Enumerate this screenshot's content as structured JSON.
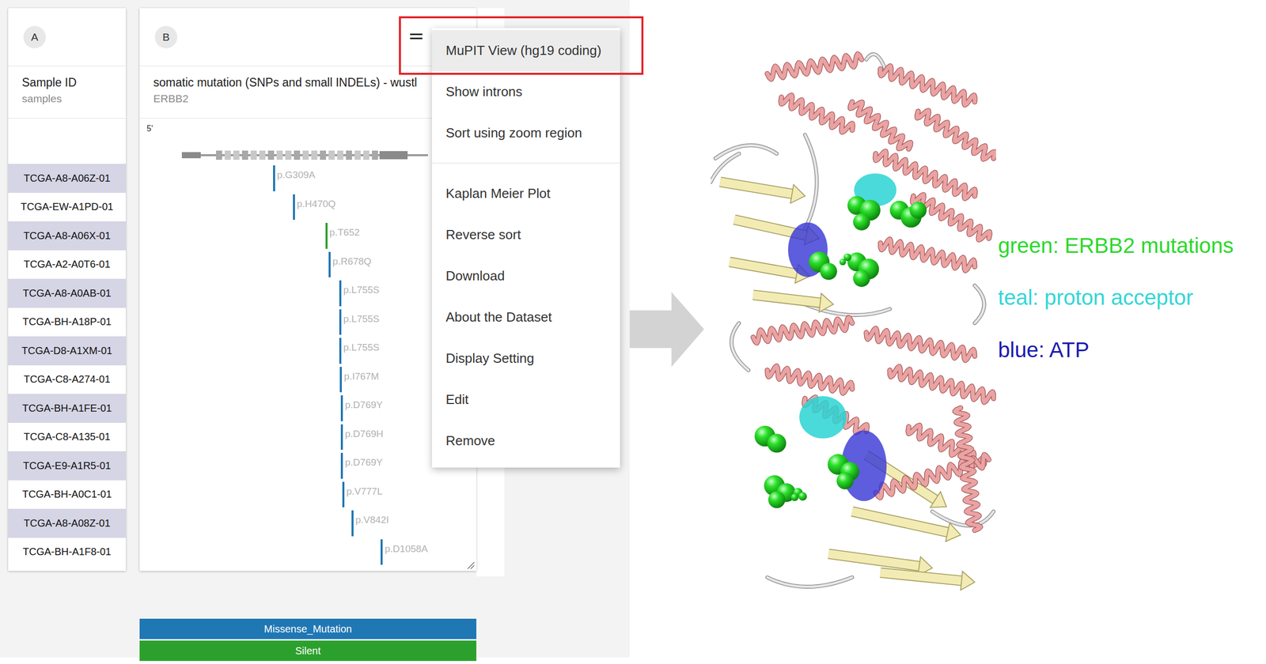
{
  "sample_column": {
    "badge": "A",
    "title": "Sample ID",
    "subtitle": "samples",
    "rows": [
      {
        "id": "TCGA-A8-A06Z-01"
      },
      {
        "id": "TCGA-EW-A1PD-01"
      },
      {
        "id": "TCGA-A8-A06X-01"
      },
      {
        "id": "TCGA-A2-A0T6-01"
      },
      {
        "id": "TCGA-A8-A0AB-01"
      },
      {
        "id": "TCGA-BH-A18P-01"
      },
      {
        "id": "TCGA-D8-A1XM-01"
      },
      {
        "id": "TCGA-C8-A274-01"
      },
      {
        "id": "TCGA-BH-A1FE-01"
      },
      {
        "id": "TCGA-C8-A135-01"
      },
      {
        "id": "TCGA-E9-A1R5-01"
      },
      {
        "id": "TCGA-BH-A0C1-01"
      },
      {
        "id": "TCGA-A8-A08Z-01"
      },
      {
        "id": "TCGA-BH-A1F8-01"
      }
    ]
  },
  "mutation_column": {
    "badge": "B",
    "title": "somatic mutation (SNPs and small INDELs) - wustl",
    "subtitle": "ERBB2",
    "strand": "5'",
    "rows": [
      {
        "label": "p.G309A",
        "level": 0.396,
        "type": "Missense_Mutation"
      },
      {
        "label": "p.H470Q",
        "level": 0.455,
        "type": "Missense_Mutation"
      },
      {
        "label": "p.T652",
        "level": 0.552,
        "type": "Silent"
      },
      {
        "label": "p.R678Q",
        "level": 0.561,
        "type": "Missense_Mutation"
      },
      {
        "label": "p.L755S",
        "level": 0.593,
        "type": "Missense_Mutation"
      },
      {
        "label": "p.L755S",
        "level": 0.593,
        "type": "Missense_Mutation"
      },
      {
        "label": "p.L755S",
        "level": 0.593,
        "type": "Missense_Mutation"
      },
      {
        "label": "p.I767M",
        "level": 0.595,
        "type": "Missense_Mutation"
      },
      {
        "label": "p.D769Y",
        "level": 0.598,
        "type": "Missense_Mutation"
      },
      {
        "label": "p.D769H",
        "level": 0.598,
        "type": "Missense_Mutation"
      },
      {
        "label": "p.D769Y",
        "level": 0.598,
        "type": "Missense_Mutation"
      },
      {
        "label": "p.V777L",
        "level": 0.602,
        "type": "Missense_Mutation"
      },
      {
        "label": "p.V842I",
        "level": 0.629,
        "type": "Missense_Mutation"
      },
      {
        "label": "p.D1058A",
        "level": 0.716,
        "type": "Missense_Mutation"
      }
    ]
  },
  "legend": [
    {
      "label": "Missense_Mutation",
      "color": "#1f77b4"
    },
    {
      "label": "Silent",
      "color": "#2ca02c"
    }
  ],
  "menu": {
    "sections": [
      [
        {
          "label": "MuPIT View (hg19 coding)",
          "highlighted": true
        },
        {
          "label": "Show introns",
          "highlighted": false
        },
        {
          "label": "Sort using zoom region",
          "highlighted": false
        }
      ],
      [
        {
          "label": "Kaplan Meier Plot",
          "highlighted": false
        },
        {
          "label": "Reverse sort",
          "highlighted": false
        },
        {
          "label": "Download",
          "highlighted": false
        },
        {
          "label": "About the Dataset",
          "highlighted": false
        },
        {
          "label": "Display Setting",
          "highlighted": false
        },
        {
          "label": "Edit",
          "highlighted": false
        },
        {
          "label": "Remove",
          "highlighted": false
        }
      ]
    ]
  },
  "structure_legend": [
    {
      "label": "green: ERBB2 mutations",
      "color": "#2bd92b"
    },
    {
      "label": "teal: proton acceptor",
      "color": "#33d6d6"
    },
    {
      "label": "blue: ATP",
      "color": "#1a1ab0"
    }
  ]
}
